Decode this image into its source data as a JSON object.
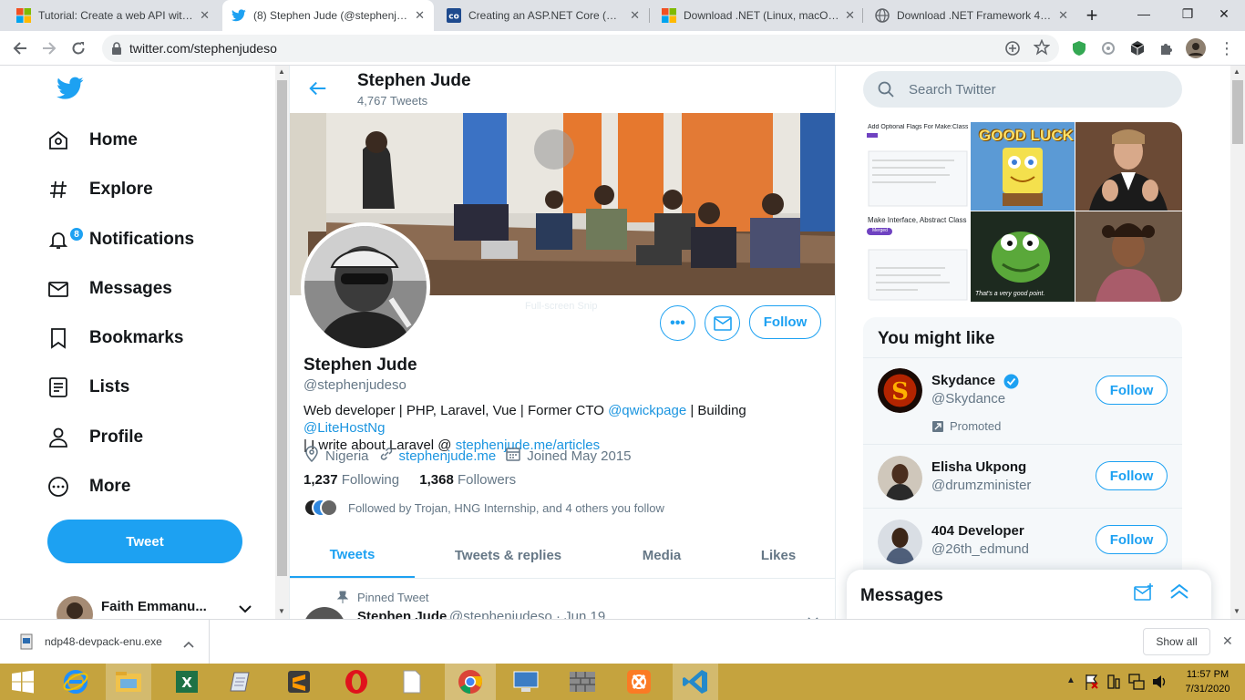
{
  "tabs": [
    {
      "title": "Tutorial: Create a web API with A",
      "icon": "windows-logo-icon"
    },
    {
      "title": "(8) Stephen Jude (@stephenjude",
      "icon": "twitter-bird-icon"
    },
    {
      "title": "Creating an ASP.NET Core (REST",
      "icon": "codingkey-icon"
    },
    {
      "title": "Download .NET (Linux, macOS, a",
      "icon": "windows-logo-icon"
    },
    {
      "title": "Download .NET Framework 4.8 |",
      "icon": "globe-icon"
    }
  ],
  "toolbar": {
    "url": "twitter.com/stephenjudeso"
  },
  "nav": {
    "items": [
      {
        "label": "Home",
        "icon": "home-icon"
      },
      {
        "label": "Explore",
        "icon": "hashtag-icon"
      },
      {
        "label": "Notifications",
        "icon": "bell-icon",
        "badge": "8"
      },
      {
        "label": "Messages",
        "icon": "envelope-icon"
      },
      {
        "label": "Bookmarks",
        "icon": "bookmark-icon"
      },
      {
        "label": "Lists",
        "icon": "list-icon"
      },
      {
        "label": "Profile",
        "icon": "person-icon"
      },
      {
        "label": "More",
        "icon": "more-circle-icon"
      }
    ],
    "tweet_label": "Tweet",
    "account_name": "Faith Emmanu..."
  },
  "profile": {
    "header_name": "Stephen Jude",
    "tweet_count": "4,767 Tweets",
    "name": "Stephen Jude",
    "handle": "@stephenjudeso",
    "bio_1": "Web developer | PHP, Laravel, Vue | Former CTO ",
    "bio_link_1": "@qwickpage",
    "bio_2": " | Building ",
    "bio_link_2": "@LiteHostNg",
    "bio_3": "| I write about Laravel @ ",
    "bio_link_3": "stephenjude.me/articles",
    "location": "Nigeria",
    "website": "stephenjude.me",
    "joined": "Joined May 2015",
    "following_count": "1,237",
    "following_label": "Following",
    "followers_count": "1,368",
    "followers_label": "Followers",
    "followed_by": "Followed by Trojan, HNG Internship, and 4 others you follow",
    "follow_label": "Follow",
    "banner_watermark": "Full-screen Snip"
  },
  "profile_tabs": [
    "Tweets",
    "Tweets & replies",
    "Media",
    "Likes"
  ],
  "pinned": {
    "label": "Pinned Tweet",
    "name": "Stephen Jude",
    "handle_date": "@stephenjudeso · Jun 19"
  },
  "search": {
    "placeholder": "Search Twitter"
  },
  "media_grid": {
    "good_luck": "GOOD LUCK",
    "kermit_caption": "That's a very good point.",
    "gh_title_1": "Add Optional Flags For Make:Class Command #3",
    "gh_title_2": "Make Interface, Abstract Class",
    "gh_merged": "Merged"
  },
  "you_might_like": {
    "title": "You might like",
    "accounts": [
      {
        "name": "Skydance",
        "handle": "@Skydance",
        "verified": true,
        "promoted": "Promoted"
      },
      {
        "name": "Elisha Ukpong",
        "handle": "@drumzminister"
      },
      {
        "name": "404 Developer",
        "handle": "@26th_edmund"
      }
    ],
    "follow_label": "Follow"
  },
  "messages_drawer": {
    "title": "Messages"
  },
  "downloads": {
    "file": "ndp48-devpack-enu.exe",
    "show_all": "Show all"
  },
  "taskbar": {
    "time": "11:57 PM",
    "date": "7/31/2020"
  },
  "colors": {
    "twitter_blue": "#1da1f2",
    "link_blue": "#1b95e0",
    "taskbar": "#c5a33e"
  }
}
